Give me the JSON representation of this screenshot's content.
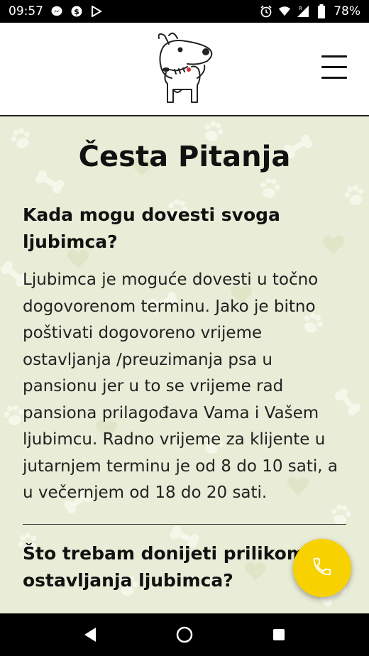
{
  "status_bar": {
    "time": "09:57",
    "battery": "78%",
    "icons_left": [
      "messenger-icon",
      "shield-dollar-icon",
      "play-store-icon"
    ],
    "icons_right": [
      "alarm-icon",
      "wifi-icon",
      "signal-icon",
      "battery-icon"
    ]
  },
  "header": {
    "logo_icon": "dog-logo-icon",
    "menu_icon": "hamburger-menu-icon"
  },
  "page": {
    "title": "Česta Pitanja",
    "faqs": [
      {
        "question": "Kada mogu dovesti svoga ljubimca?",
        "answer": "Ljubimca je moguće dovesti u točno dogovorenom terminu. Jako je bitno poštivati dogovoreno vrijeme ostavljanja /preuzimanja psa u pansionu jer u to se vrijeme rad pansiona prilagođava Vama i Vašem ljubimcu. Radno vrijeme za klijente u jutarnjem terminu je od 8 do 10 sati, a u večernjem od 18 do 20 sati."
      },
      {
        "question": "Što trebam donijeti prilikom ostavljanja ljubimca?"
      }
    ]
  },
  "fab": {
    "icon": "phone-icon",
    "color": "#f7d100"
  },
  "colors": {
    "background": "#e9ecd6",
    "accent": "#f7d100"
  }
}
